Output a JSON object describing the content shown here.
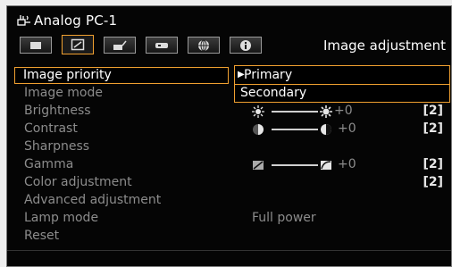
{
  "header": {
    "source_icon": "input-source-icon",
    "source_title": "Analog PC-1",
    "section_title": "Image adjustment"
  },
  "tabs": [
    {
      "name": "tab-display",
      "icon": "monitor-icon",
      "active": false
    },
    {
      "name": "tab-image-adjustment",
      "icon": "image-adjust-icon",
      "active": true
    },
    {
      "name": "tab-install",
      "icon": "install-icon",
      "active": false
    },
    {
      "name": "tab-system",
      "icon": "system-icon",
      "active": false
    },
    {
      "name": "tab-network",
      "icon": "globe-icon",
      "active": false
    },
    {
      "name": "tab-info",
      "icon": "info-icon",
      "active": false
    }
  ],
  "menu": {
    "items": [
      {
        "label": "Image priority"
      },
      {
        "label": "Image mode"
      },
      {
        "label": "Brightness",
        "value": "+0",
        "icons": [
          "brightness-low-icon",
          "brightness-high-icon"
        ],
        "bracket": "[2]"
      },
      {
        "label": "Contrast",
        "value": "+0",
        "icons": [
          "contrast-low-icon",
          "contrast-high-icon"
        ],
        "bracket": "[2]"
      },
      {
        "label": "Sharpness"
      },
      {
        "label": "Gamma",
        "value": "+0",
        "icons": [
          "gamma-low-icon",
          "gamma-high-icon"
        ],
        "bracket": "[2]"
      },
      {
        "label": "Color adjustment",
        "bracket": "[2]"
      },
      {
        "label": "Advanced adjustment"
      },
      {
        "label": "Lamp mode",
        "value": "Full power"
      },
      {
        "label": "Reset"
      }
    ]
  },
  "popup": {
    "options": [
      "Primary",
      "Secondary"
    ],
    "selected_marker": "▶"
  },
  "colors": {
    "accent": "#f0a030",
    "text_active": "#ffffff",
    "text_inactive": "#8c8c8c",
    "background": "#050505"
  }
}
